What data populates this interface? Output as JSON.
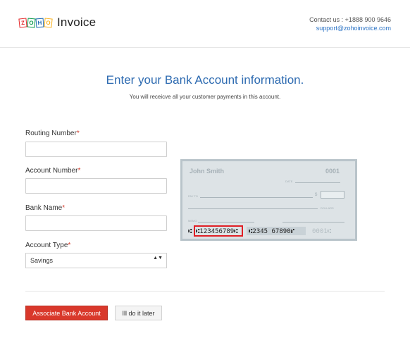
{
  "header": {
    "logo_letters": [
      "Z",
      "O",
      "H",
      "O"
    ],
    "product": "Invoice",
    "contact_line": "Contact us : +1888 900 9646",
    "email": "support@zohoinvoice.com"
  },
  "main": {
    "title": "Enter your Bank Account information.",
    "subtitle": "You will receicve all your customer payments in this account."
  },
  "form": {
    "required_mark": "*",
    "routing_label": "Routing Number",
    "routing_value": "",
    "account_label": "Account Number",
    "account_value": "",
    "bank_label": "Bank Name",
    "bank_value": "",
    "type_label": "Account Type",
    "type_value": "Savings",
    "type_arrows": "▲▼"
  },
  "check": {
    "holder": "John Smith",
    "number": "0001",
    "date_label": "DATE",
    "pay_to_label": "PAY TO",
    "currency": "$",
    "dollars_label": "DOLLARS",
    "memo_label": "MEMO",
    "micr_start": "⑆",
    "routing_digits": "⑆123456789⑆",
    "account_digits": "⑆2345 67890⑈",
    "check_digits": "0001⑆"
  },
  "actions": {
    "primary": "Associate Bank Account",
    "secondary": "Ill do it later"
  },
  "colors": {
    "accent": "#2e6bb1",
    "primary_button": "#d9382b",
    "required": "#d43b2b",
    "highlight_box": "#e01f25"
  }
}
